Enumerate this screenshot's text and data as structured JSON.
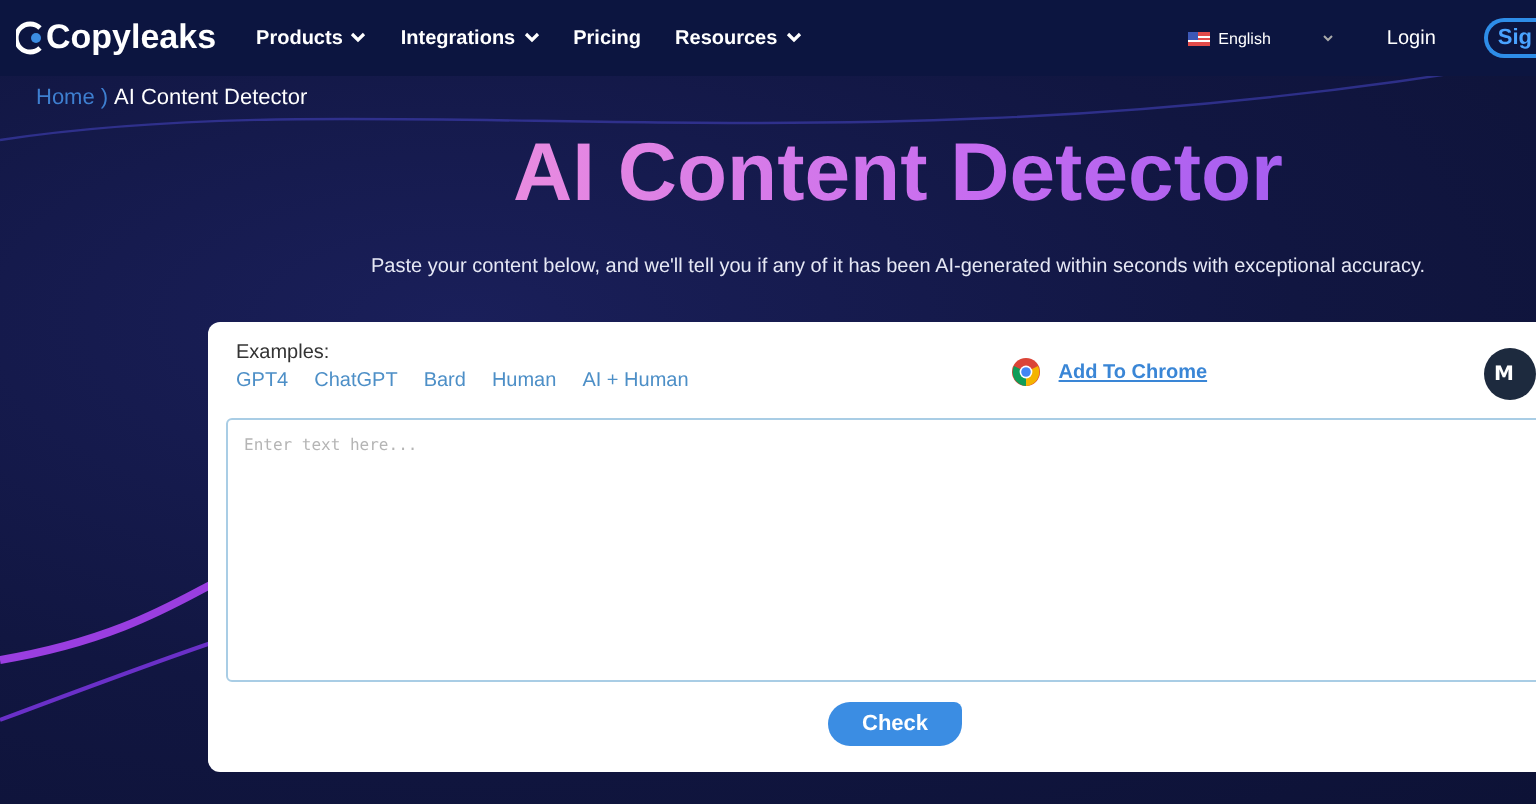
{
  "nav": {
    "logo": "Copyleaks",
    "items": [
      {
        "label": "Products",
        "dropdown": true
      },
      {
        "label": "Integrations",
        "dropdown": true
      },
      {
        "label": "Pricing",
        "dropdown": false
      },
      {
        "label": "Resources",
        "dropdown": true
      }
    ],
    "language": "English",
    "login": "Login",
    "signup": "Sig"
  },
  "breadcrumb": {
    "home": "Home",
    "separator": ")",
    "current": "AI Content Detector"
  },
  "title": "AI Content Detector",
  "subtitle": "Paste your content below, and we'll tell you if any of it has been AI-generated within seconds with exceptional accuracy.",
  "card": {
    "examples_label": "Examples:",
    "examples": [
      "GPT4",
      "ChatGPT",
      "Bard",
      "Human",
      "AI + Human"
    ],
    "extension_link": "Add To Chrome",
    "avatar": "M",
    "textarea": {
      "placeholder": "Enter text here..."
    },
    "button": "Check"
  }
}
